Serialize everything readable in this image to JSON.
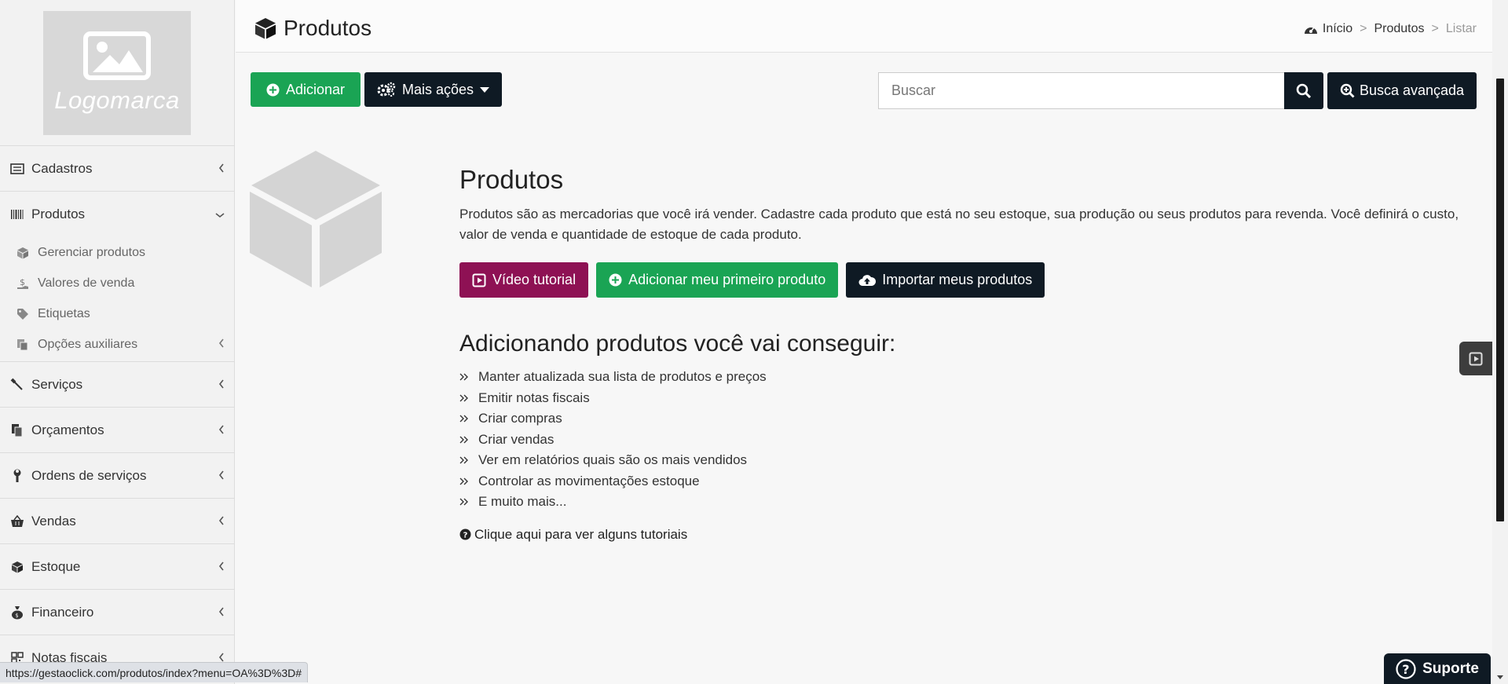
{
  "sidebar": {
    "logo_text": "Logomarca",
    "items": [
      {
        "label": "Cadastros"
      },
      {
        "label": "Produtos"
      },
      {
        "label": "Serviços"
      },
      {
        "label": "Orçamentos"
      },
      {
        "label": "Ordens de serviços"
      },
      {
        "label": "Vendas"
      },
      {
        "label": "Estoque"
      },
      {
        "label": "Financeiro"
      },
      {
        "label": "Notas fiscais"
      }
    ],
    "produtos_sub": [
      {
        "label": "Gerenciar produtos"
      },
      {
        "label": "Valores de venda"
      },
      {
        "label": "Etiquetas"
      },
      {
        "label": "Opções auxiliares"
      }
    ]
  },
  "header": {
    "title": "Produtos",
    "breadcrumb": {
      "home": "Início",
      "section": "Produtos",
      "current": "Listar",
      "separator": ">"
    }
  },
  "toolbar": {
    "add_label": "Adicionar",
    "more_label": "Mais ações",
    "search_placeholder": "Buscar",
    "advanced_search_label": "Busca avançada"
  },
  "empty_state": {
    "title": "Produtos",
    "description": "Produtos são as mercadorias que você irá vender. Cadastre cada produto que está no seu estoque, sua produção ou seus produtos para revenda. Você definirá o custo, valor de venda e quantidade de estoque de cada produto.",
    "video_label": "Vídeo tutorial",
    "add_first_label": "Adicionar meu primeiro produto",
    "import_label": "Importar meus produtos",
    "benefits_title": "Adicionando produtos você vai conseguir:",
    "benefits": [
      "Manter atualizada sua lista de produtos e preços",
      "Emitir notas fiscais",
      "Criar compras",
      "Criar vendas",
      "Ver em relatórios quais são os mais vendidos",
      "Controlar as movimentações estoque",
      "E muito mais..."
    ],
    "tutorial_link": "Clique aqui para ver alguns tutoriais"
  },
  "support": {
    "label": "Suporte"
  },
  "status_bar": {
    "url": "https://gestaoclick.com/produtos/index?menu=OA%3D%3D#"
  },
  "colors": {
    "green": "#1aa454",
    "dark": "#0f1a24",
    "purple": "#8e1154"
  }
}
